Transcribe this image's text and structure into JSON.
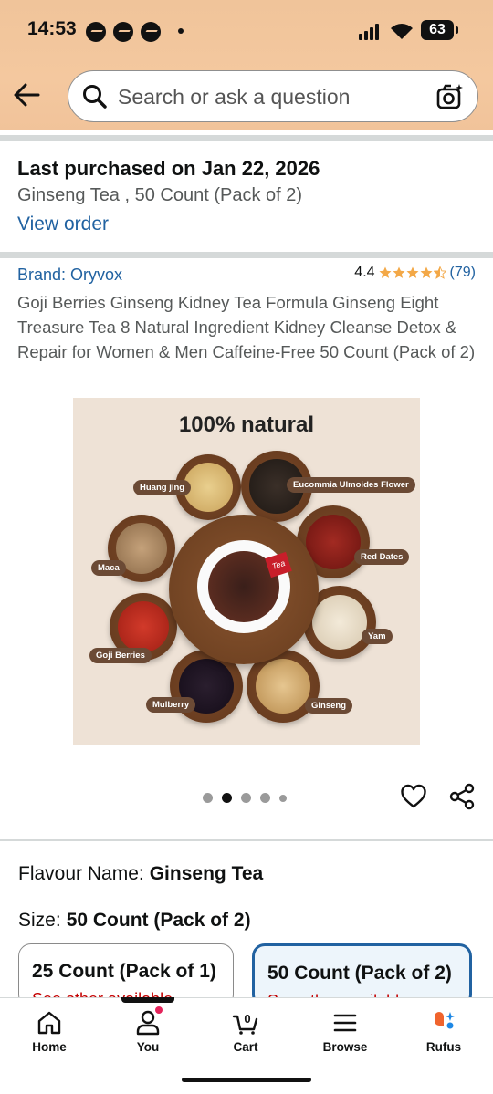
{
  "status_bar": {
    "time": "14:53",
    "battery": "63"
  },
  "search": {
    "placeholder": "Search or ask a question"
  },
  "last_purchased": {
    "title": "Last purchased on Jan 22, 2026",
    "item": "Ginseng Tea , 50 Count (Pack of 2)",
    "link": "View order"
  },
  "product": {
    "brand": "Brand: Oryvox",
    "rating": "4.4",
    "rating_stars": 4.4,
    "rating_count": "(79)",
    "title": "Goji Berries Ginseng Kidney Tea Formula Ginseng Eight Treasure Tea 8 Natural Ingredient Kidney Cleanse Detox & Repair for Women & Men Caffeine-Free 50 Count (Pack of 2)",
    "image": {
      "headline": "100% natural",
      "tea_tag": "Tea",
      "ingredients": [
        "Huang jing",
        "Eucommia Ulmoides Flower",
        "Maca",
        "Red Dates",
        "Goji Berries",
        "Yam",
        "Mulberry",
        "Ginseng"
      ]
    },
    "carousel": {
      "count": 5,
      "active_index": 1
    }
  },
  "variations": {
    "flavour_label": "Flavour Name:",
    "flavour_value": "Ginseng Tea",
    "size_label": "Size:",
    "size_value": "50 Count (Pack of 2)",
    "options": [
      {
        "label": "25 Count (Pack of 1)",
        "sub": "See other available",
        "selected": false
      },
      {
        "label": "50 Count (Pack of 2)",
        "sub": "See other available",
        "selected": true
      }
    ]
  },
  "bottom_nav": {
    "home": "Home",
    "you": "You",
    "cart": "Cart",
    "cart_count": "0",
    "browse": "Browse",
    "rufus": "Rufus"
  },
  "colors": {
    "link": "#2162a1",
    "star": "#f3a847",
    "header": "#f3c69c",
    "selected_border": "#2162a1"
  }
}
